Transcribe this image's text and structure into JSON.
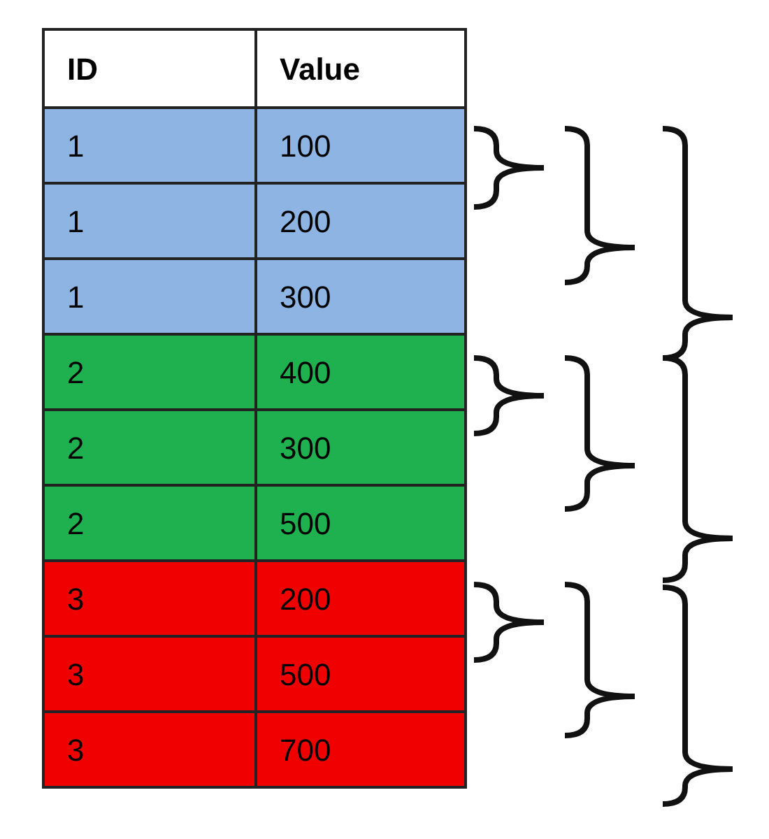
{
  "table": {
    "columns": [
      "ID",
      "Value"
    ],
    "rows": [
      {
        "cells": [
          "1",
          "100"
        ],
        "color": "#8eb4e3"
      },
      {
        "cells": [
          "1",
          "200"
        ],
        "color": "#8eb4e3"
      },
      {
        "cells": [
          "1",
          "300"
        ],
        "color": "#8eb4e3"
      },
      {
        "cells": [
          "2",
          "400"
        ],
        "color": "#1fb04f"
      },
      {
        "cells": [
          "2",
          "300"
        ],
        "color": "#1fb04f"
      },
      {
        "cells": [
          "2",
          "500"
        ],
        "color": "#1fb04f"
      },
      {
        "cells": [
          "3",
          "200"
        ],
        "color": "#f00000"
      },
      {
        "cells": [
          "3",
          "500"
        ],
        "color": "#f00000"
      },
      {
        "cells": [
          "3",
          "700"
        ],
        "color": "#f00000"
      }
    ]
  }
}
